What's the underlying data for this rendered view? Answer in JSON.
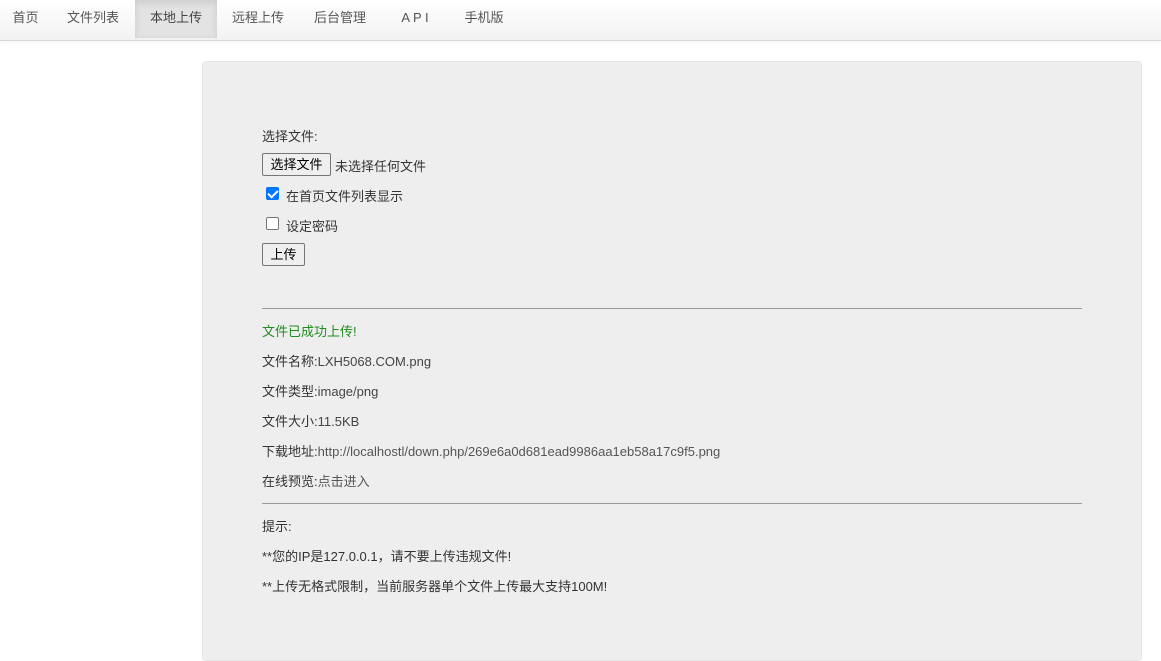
{
  "nav": {
    "items": [
      {
        "label": "首页"
      },
      {
        "label": "文件列表"
      },
      {
        "label": "本地上传"
      },
      {
        "label": "远程上传"
      },
      {
        "label": "后台管理"
      },
      {
        "label": "A P I"
      },
      {
        "label": "手机版"
      }
    ],
    "active_index": 2
  },
  "form": {
    "select_label": "选择文件:",
    "file_button": "选择文件",
    "file_status": "未选择任何文件",
    "show_on_home": {
      "label": "在首页文件列表显示",
      "checked": true
    },
    "set_password": {
      "label": "设定密码",
      "checked": false
    },
    "upload_button": "上传"
  },
  "result": {
    "success_message": "文件已成功上传!",
    "name_label": "文件名称:",
    "name_value": "LXH5068.COM.png",
    "type_label": "文件类型:",
    "type_value": "image/png",
    "size_label": "文件大小:",
    "size_value": "11.5KB",
    "download_label": "下载地址:",
    "download_value": "http://localhostl/down.php/269e6a0d681ead9986aa1eb58a17c9f5.png",
    "preview_label": "在线预览:",
    "preview_link": "点击进入"
  },
  "tips": {
    "title": "提示:",
    "line1": "**您的IP是127.0.0.1，请不要上传违规文件!",
    "line2": "**上传无格式限制，当前服务器单个文件上传最大支持100M!"
  },
  "colors": {
    "success": "#228b22",
    "panel_bg": "#eeeeee",
    "checkbox_accent": "#0075ff"
  }
}
